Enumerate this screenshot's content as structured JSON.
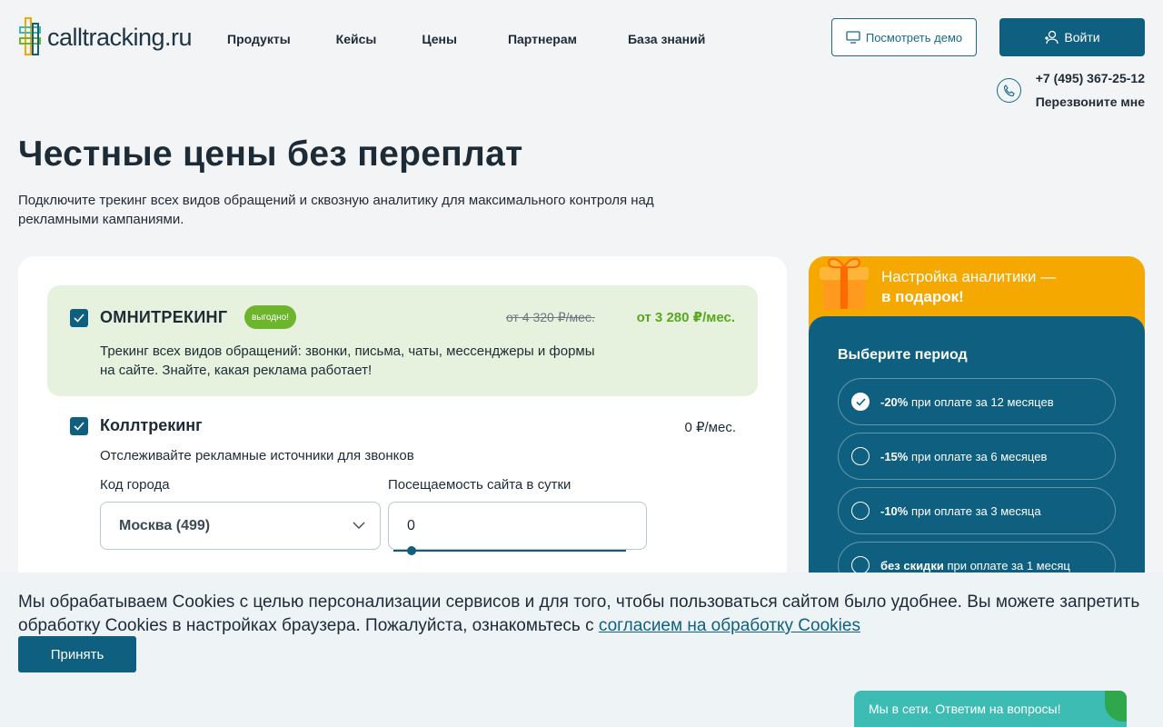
{
  "brand": {
    "name": "calltracking.ru"
  },
  "nav": [
    {
      "label": "Продукты"
    },
    {
      "label": "Кейсы"
    },
    {
      "label": "Цены"
    },
    {
      "label": "Партнерам"
    },
    {
      "label": "База знаний"
    }
  ],
  "header": {
    "demo_label": "Посмотреть демо",
    "login_label": "Войти",
    "phone": "+7 (495) 367-25-12",
    "callback_label": "Перезвоните мне"
  },
  "hero": {
    "title": "Честные цены без переплат",
    "subtitle": "Подключите трекинг всех видов обращений и сквозную аналитику для максимального контроля над рекламными кампаниями."
  },
  "omni": {
    "checked": true,
    "title": "ОМНИТРЕКИНГ",
    "badge": "выгодно!",
    "old_price": "от 4 320 ₽/мес.",
    "new_price": "от 3 280 ₽/мес.",
    "description": "Трекинг всех видов обращений: звонки, письма, чаты, мессенджеры и формы на сайте. Знайте, какая реклама работает!"
  },
  "calltracking": {
    "checked": true,
    "title": "Коллтрекинг",
    "price": "0 ₽/мес.",
    "description": "Отслеживайте рекламные источники для звонков",
    "city_label": "Код города",
    "city_value": "Москва (499)",
    "visits_label": "Посещаемость сайта в сутки",
    "visits_value": "0"
  },
  "gift": {
    "line1": "Настройка аналитики —",
    "line2": "в подарок!"
  },
  "period": {
    "title": "Выберите период",
    "options": [
      {
        "discount": "-20%",
        "text": "при оплате за 12 месяцев",
        "selected": true
      },
      {
        "discount": "-15%",
        "text": "при оплате за 6 месяцев",
        "selected": false
      },
      {
        "discount": "-10%",
        "text": "при оплате за 3 месяца",
        "selected": false
      },
      {
        "discount": "без скидки",
        "text": "при оплате за 1 месяц",
        "selected": false
      }
    ]
  },
  "cookie": {
    "text": "Мы обрабатываем Cookies с целью персонализации сервисов и для того, чтобы пользоваться сайтом было удобнее. Вы можете запретить обработку Cookies в настройках браузера. Пожалуйста, ознакомьтесь с ",
    "link": "согласием на обработку Cookies",
    "accept_label": "Принять"
  },
  "chat": {
    "label": "Мы в сети. Ответим на вопросы!"
  },
  "colors": {
    "primary": "#0f5f80",
    "accent_green": "#57a81e",
    "gift_orange": "#f5a800",
    "chat_teal": "#3cbcb3"
  }
}
